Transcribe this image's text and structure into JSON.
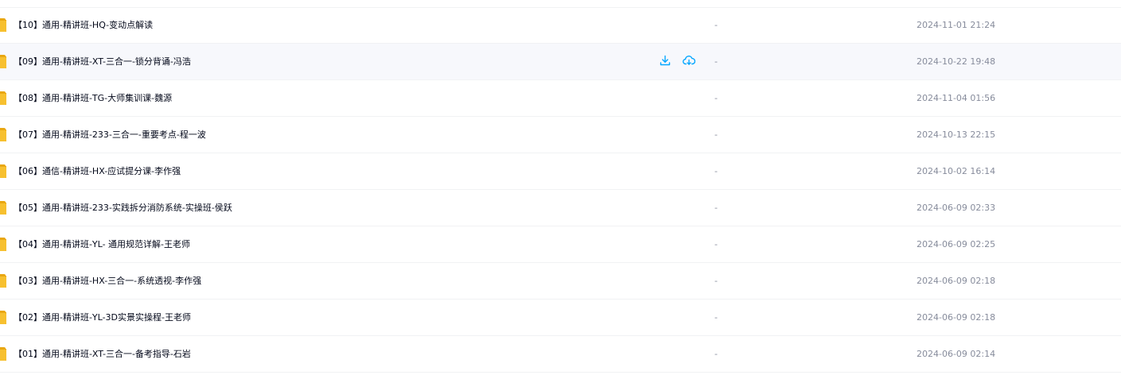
{
  "colors": {
    "folder": "#f7c02f",
    "action_icon": "#06a7ff",
    "hover_bg": "#f7f8fc"
  },
  "hovered_row": 1,
  "row_actions": [
    {
      "icon": "download-icon"
    },
    {
      "icon": "cloud-save-icon"
    }
  ],
  "files": [
    {
      "icon": "folder-icon",
      "name": "【10】通用-精讲班-HQ-变动点解读",
      "size": "-",
      "modified": "2024-11-01 21:24"
    },
    {
      "icon": "folder-icon",
      "name": "【09】通用-精讲班-XT-三合一-锁分背诵-冯浩",
      "size": "-",
      "modified": "2024-10-22 19:48"
    },
    {
      "icon": "folder-icon",
      "name": "【08】通用-精讲班-TG-大师集训课-魏源",
      "size": "-",
      "modified": "2024-11-04 01:56"
    },
    {
      "icon": "folder-icon",
      "name": "【07】通用-精讲班-233-三合一-重要考点-程一波",
      "size": "-",
      "modified": "2024-10-13 22:15"
    },
    {
      "icon": "folder-icon",
      "name": "【06】通信-精讲班-HX-应试提分课-李作强",
      "size": "-",
      "modified": "2024-10-02 16:14"
    },
    {
      "icon": "folder-icon",
      "name": "【05】通用-精讲班-233-实践拆分消防系统-实操班-侯跃",
      "size": "-",
      "modified": "2024-06-09 02:33"
    },
    {
      "icon": "folder-icon",
      "name": "【04】通用-精讲班-YL- 通用规范详解-王老师",
      "size": "-",
      "modified": "2024-06-09 02:25"
    },
    {
      "icon": "folder-icon",
      "name": "【03】通用-精讲班-HX-三合一-系统透视-李作强",
      "size": "-",
      "modified": "2024-06-09 02:18"
    },
    {
      "icon": "folder-icon",
      "name": "【02】通用-精讲班-YL-3D实景实操程-王老师",
      "size": "-",
      "modified": "2024-06-09 02:18"
    },
    {
      "icon": "folder-icon",
      "name": "【01】通用-精讲班-XT-三合一-备考指导-石岩",
      "size": "-",
      "modified": "2024-06-09 02:14"
    }
  ]
}
